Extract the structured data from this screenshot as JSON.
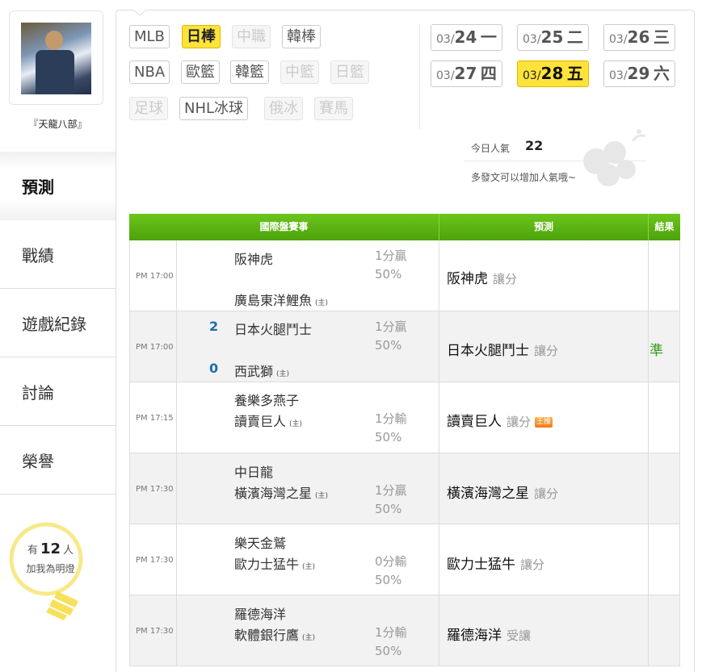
{
  "profile": {
    "nickname": "『天龍八部』"
  },
  "sidebar": {
    "items": [
      {
        "label": "預測",
        "active": true
      },
      {
        "label": "戰績"
      },
      {
        "label": "遊戲紀錄"
      },
      {
        "label": "討論"
      },
      {
        "label": "榮譽"
      }
    ],
    "lamp": {
      "prefix": "有",
      "count": "12",
      "suffix": "人",
      "text": "加我為明燈"
    }
  },
  "leagues": [
    {
      "label": "MLB",
      "state": "normal"
    },
    {
      "label": "日棒",
      "state": "active"
    },
    {
      "label": "中職",
      "state": "disabled"
    },
    {
      "label": "韓棒",
      "state": "normal"
    },
    {
      "label": "NBA",
      "state": "normal"
    },
    {
      "label": "歐籃",
      "state": "normal"
    },
    {
      "label": "韓籃",
      "state": "normal"
    },
    {
      "label": "中籃",
      "state": "disabled"
    },
    {
      "label": "日籃",
      "state": "disabled"
    },
    {
      "label": "足球",
      "state": "disabled"
    },
    {
      "label": "NHL冰球",
      "state": "normal"
    },
    {
      "label": "俄冰",
      "state": "disabled"
    },
    {
      "label": "賽馬",
      "state": "disabled"
    }
  ],
  "dates": [
    {
      "month": "03/",
      "day": "24",
      "weekday": "一"
    },
    {
      "month": "03/",
      "day": "25",
      "weekday": "二"
    },
    {
      "month": "03/",
      "day": "26",
      "weekday": "三"
    },
    {
      "month": "03/",
      "day": "27",
      "weekday": "四"
    },
    {
      "month": "03/",
      "day": "28",
      "weekday": "五",
      "active": true
    },
    {
      "month": "03/",
      "day": "29",
      "weekday": "六"
    }
  ],
  "popularity": {
    "label": "今日人氣",
    "value": "22",
    "hint": "多發文可以增加人氣哦~"
  },
  "table": {
    "headers": {
      "match": "國際盤賽事",
      "prediction": "預測",
      "result": "結果"
    },
    "home_mark": "(主)",
    "rows": [
      {
        "time": "PM 17:00",
        "away": "阪神虎",
        "home": "廣島東洋鯉魚",
        "away_score": "",
        "home_score": "",
        "spread": "1分贏",
        "pct": "50%",
        "pick": "阪神虎",
        "pick_type": "讓分",
        "king": "",
        "result": ""
      },
      {
        "time": "PM 17:00",
        "away": "日本火腿鬥士",
        "home": "西武獅",
        "away_score": "2",
        "home_score": "0",
        "spread": "1分贏",
        "pct": "50%",
        "pick": "日本火腿鬥士",
        "pick_type": "讓分",
        "king": "",
        "result": "準"
      },
      {
        "time": "PM 17:15",
        "away": "養樂多燕子",
        "home": "讀賣巨人",
        "away_score": "",
        "home_score": "",
        "spread": "1分輸",
        "pct": "50%",
        "pick": "讀賣巨人",
        "pick_type": "讓分",
        "king": "王推",
        "result": ""
      },
      {
        "time": "PM 17:30",
        "away": "中日龍",
        "home": "橫濱海灣之星",
        "away_score": "",
        "home_score": "",
        "spread": "1分贏",
        "pct": "50%",
        "pick": "橫濱海灣之星",
        "pick_type": "讓分",
        "king": "",
        "result": ""
      },
      {
        "time": "PM 17:30",
        "away": "樂天金鷲",
        "home": "歐力士猛牛",
        "away_score": "",
        "home_score": "",
        "spread": "0分輸",
        "pct": "50%",
        "pick": "歐力士猛牛",
        "pick_type": "讓分",
        "king": "",
        "result": ""
      },
      {
        "time": "PM 17:30",
        "away": "羅德海洋",
        "home": "軟體銀行鷹",
        "away_score": "",
        "home_score": "",
        "spread": "1分輸",
        "pct": "50%",
        "pick": "羅德海洋",
        "pick_type": "受讓",
        "king": "",
        "result": ""
      }
    ]
  },
  "colors": {
    "accent_yellow": "#ffe33b",
    "header_green": "#5cb312",
    "score_blue": "#1d6ea8",
    "result_green": "#2e9b16"
  }
}
